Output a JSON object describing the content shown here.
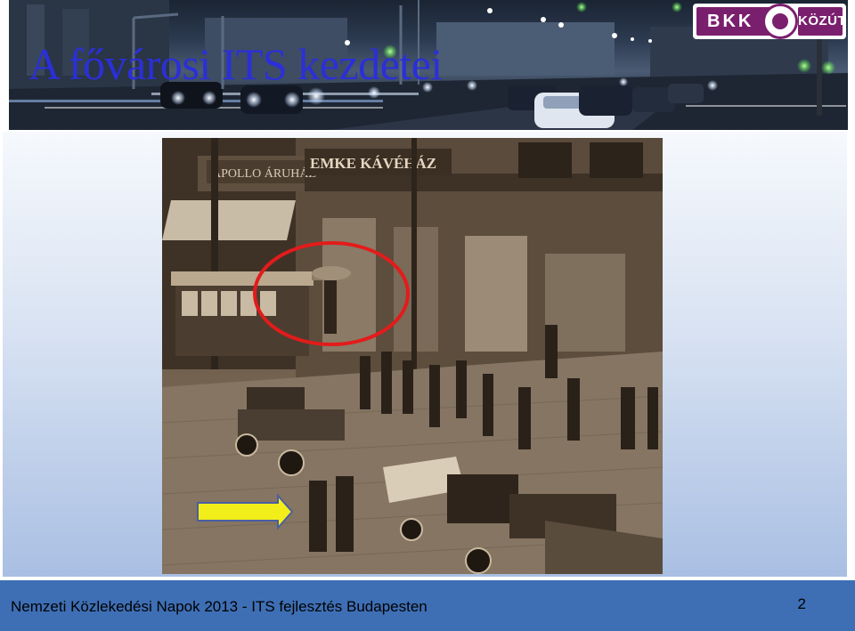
{
  "slide": {
    "title": "A fővárosi ITS kezdetei"
  },
  "logo": {
    "left_text": "BKK",
    "right_text": "KÖZÚT"
  },
  "photo": {
    "shop_sign_left": "APOLLO ÁRUHÁZ",
    "shop_sign_center": "EMKE KÁVÉHÁZ",
    "annotation_circle_color": "#e31b1b",
    "arrow_color": "#f2ee1a"
  },
  "footer": {
    "text": "Nemzeti Közlekedési Napok 2013 - ITS fejlesztés Budapesten",
    "page_number": "2"
  }
}
